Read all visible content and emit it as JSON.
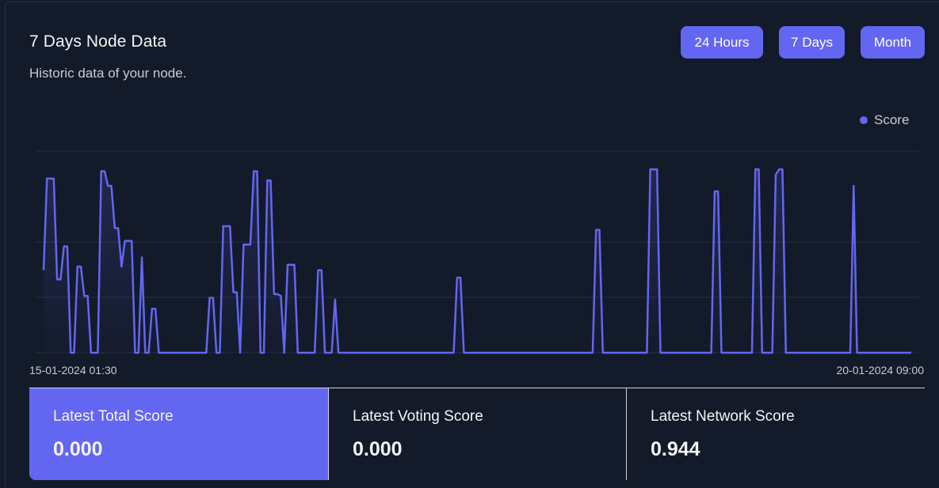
{
  "header": {
    "title": "7 Days Node Data",
    "subtitle": "Historic data of your node."
  },
  "range_buttons": {
    "hours24": "24 Hours",
    "days7": "7 Days",
    "month": "Month"
  },
  "colors": {
    "accent": "#6366f1",
    "background": "#131a29",
    "grid": "#26303f"
  },
  "chart_data": {
    "type": "line",
    "legend": [
      "Score"
    ],
    "legend_position": "top-right",
    "grid": true,
    "x_start_label": "15-01-2024 01:30",
    "x_end_label": "20-01-2024 09:00",
    "ylim": [
      0,
      1.1
    ],
    "series": [
      {
        "name": "Score",
        "values": [
          0.45,
          0.95,
          0.95,
          0.95,
          0.4,
          0.4,
          0.58,
          0.58,
          0.0,
          0.0,
          0.47,
          0.47,
          0.31,
          0.31,
          0.0,
          0.0,
          0.0,
          0.99,
          0.99,
          0.91,
          0.91,
          0.68,
          0.68,
          0.47,
          0.61,
          0.61,
          0.61,
          0.0,
          0.0,
          0.52,
          0.0,
          0.0,
          0.24,
          0.24,
          0.0,
          0.0,
          0.0,
          0.0,
          0.0,
          0.0,
          0.0,
          0.0,
          0.0,
          0.0,
          0.0,
          0.0,
          0.0,
          0.0,
          0.0,
          0.3,
          0.3,
          0.0,
          0.0,
          0.69,
          0.69,
          0.69,
          0.33,
          0.33,
          0.0,
          0.59,
          0.59,
          0.59,
          0.99,
          0.99,
          0.0,
          0.0,
          0.94,
          0.94,
          0.32,
          0.32,
          0.31,
          0.0,
          0.48,
          0.48,
          0.48,
          0.0,
          0.0,
          0.0,
          0.0,
          0.0,
          0.0,
          0.45,
          0.45,
          0.0,
          0.0,
          0.0,
          0.29,
          0.0,
          0.0,
          0.0,
          0.0,
          0.0,
          0.0,
          0.0,
          0.0,
          0.0,
          0.0,
          0.0,
          0.0,
          0.0,
          0.0,
          0.0,
          0.0,
          0.0,
          0.0,
          0.0,
          0.0,
          0.0,
          0.0,
          0.0,
          0.0,
          0.0,
          0.0,
          0.0,
          0.0,
          0.0,
          0.0,
          0.0,
          0.0,
          0.0,
          0.0,
          0.0,
          0.41,
          0.41,
          0.0,
          0.0,
          0.0,
          0.0,
          0.0,
          0.0,
          0.0,
          0.0,
          0.0,
          0.0,
          0.0,
          0.0,
          0.0,
          0.0,
          0.0,
          0.0,
          0.0,
          0.0,
          0.0,
          0.0,
          0.0,
          0.0,
          0.0,
          0.0,
          0.0,
          0.0,
          0.0,
          0.0,
          0.0,
          0.0,
          0.0,
          0.0,
          0.0,
          0.0,
          0.0,
          0.0,
          0.0,
          0.0,
          0.0,
          0.67,
          0.67,
          0.0,
          0.0,
          0.0,
          0.0,
          0.0,
          0.0,
          0.0,
          0.0,
          0.0,
          0.0,
          0.0,
          0.0,
          0.0,
          0.0,
          1.0,
          1.0,
          1.0,
          0.0,
          0.0,
          0.0,
          0.0,
          0.0,
          0.0,
          0.0,
          0.0,
          0.0,
          0.0,
          0.0,
          0.0,
          0.0,
          0.0,
          0.0,
          0.0,
          0.88,
          0.88,
          0.0,
          0.0,
          0.0,
          0.0,
          0.0,
          0.0,
          0.0,
          0.0,
          0.0,
          0.0,
          1.0,
          1.0,
          0.0,
          0.0,
          0.0,
          0.0,
          0.97,
          1.0,
          1.0,
          0.0,
          0.0,
          0.0,
          0.0,
          0.0,
          0.0,
          0.0,
          0.0,
          0.0,
          0.0,
          0.0,
          0.0,
          0.0,
          0.0,
          0.0,
          0.0,
          0.0,
          0.0,
          0.0,
          0.0,
          0.91,
          0.0,
          0.0,
          0.0,
          0.0,
          0.0,
          0.0,
          0.0,
          0.0,
          0.0,
          0.0,
          0.0,
          0.0,
          0.0,
          0.0,
          0.0,
          0.0,
          0.0
        ]
      }
    ]
  },
  "stats": [
    {
      "label": "Latest Total Score",
      "value": "0.000"
    },
    {
      "label": "Latest Voting Score",
      "value": "0.000"
    },
    {
      "label": "Latest Network Score",
      "value": "0.944"
    }
  ]
}
